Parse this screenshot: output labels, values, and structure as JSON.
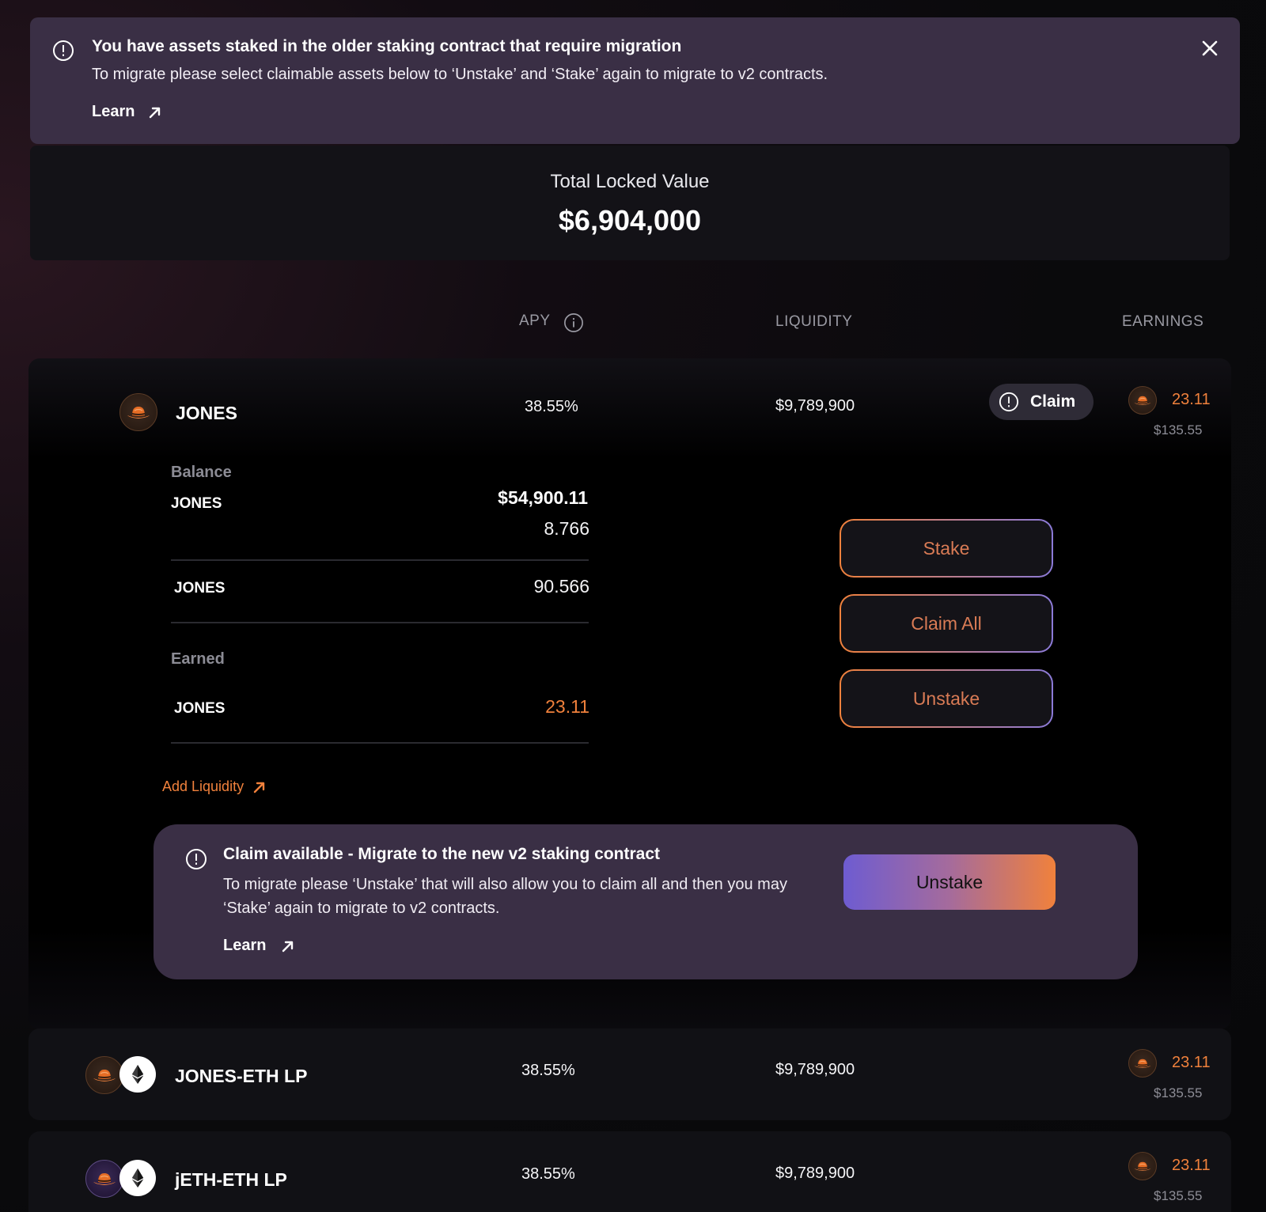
{
  "banner": {
    "title": "You have assets staked in the older staking contract that require migration",
    "description": "To migrate please select claimable assets below to ‘Unstake’ and ‘Stake’ again to migrate to v2 contracts.",
    "learn_label": "Learn"
  },
  "tvl": {
    "label": "Total Locked Value",
    "value": "$6,904,000"
  },
  "columns": {
    "apy": "APY",
    "liquidity": "LIQUIDITY",
    "earnings": "EARNINGS"
  },
  "pools": [
    {
      "name": "JONES",
      "apy": "38.55%",
      "liquidity": "$9,789,900",
      "claim_label": "Claim",
      "earnings": "23.11",
      "earnings_usd": "$135.55",
      "balance_label": "Balance",
      "balance_token": "JONES",
      "balance_usd": "$54,900.11",
      "balance_amount": "8.766",
      "staked_token": "JONES",
      "staked_amount": "90.566",
      "earned_label": "Earned",
      "earned_token": "JONES",
      "earned_amount": "23.11",
      "add_liquidity_label": "Add Liquidity",
      "actions": {
        "stake": "Stake",
        "claim_all": "Claim All",
        "unstake": "Unstake"
      },
      "migrate": {
        "title": "Claim available - Migrate to the new v2 staking contract",
        "description": "To migrate please ‘Unstake’ that will also allow you to claim all and then you may ‘Stake’ again to migrate to v2 contracts.",
        "learn_label": "Learn",
        "button_label": "Unstake"
      }
    },
    {
      "name": "JONES-ETH LP",
      "apy": "38.55%",
      "liquidity": "$9,789,900",
      "earnings": "23.11",
      "earnings_usd": "$135.55"
    },
    {
      "name": "jETH-ETH LP",
      "apy": "38.55%",
      "liquidity": "$9,789,900",
      "earnings": "23.11",
      "earnings_usd": "$135.55"
    }
  ],
  "colors": {
    "accent_orange": "#f0813c",
    "accent_purple": "#6e5cd1",
    "banner_bg": "#3a2f45"
  },
  "icons": {
    "info": "info-circle-icon",
    "close": "close-icon",
    "external": "arrow-up-right-icon",
    "token_jones": "jones-hat-icon",
    "token_eth": "ethereum-icon"
  }
}
